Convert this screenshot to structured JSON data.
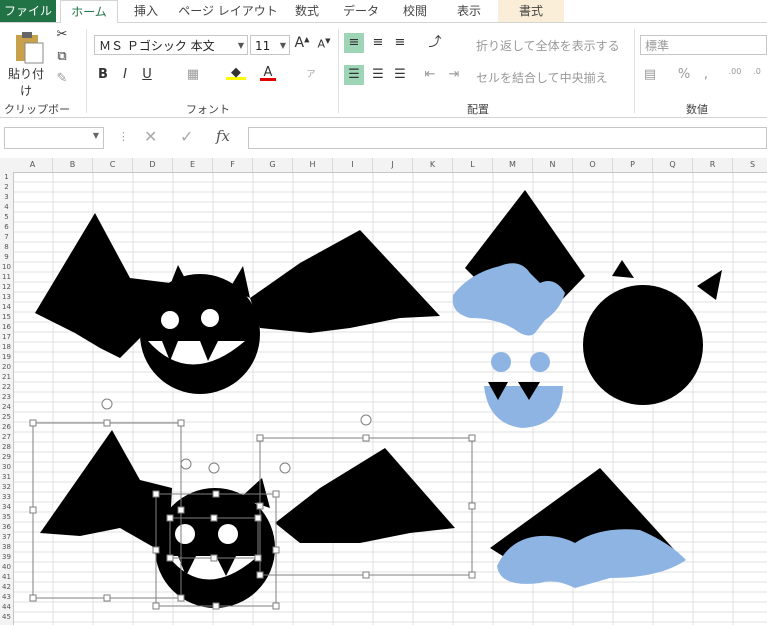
{
  "tabs": [
    "ファイル",
    "ホーム",
    "挿入",
    "ページ レイアウト",
    "数式",
    "データ",
    "校閲",
    "表示",
    "書式"
  ],
  "ribbon": {
    "clipboard": {
      "paste": "貼り付け",
      "label": "クリップボード"
    },
    "font": {
      "name": "ＭＳ Ｐゴシック 本文",
      "size": "11",
      "label": "フォント",
      "bold": "B",
      "italic": "I",
      "underline": "U"
    },
    "alignment": {
      "wrap": "折り返して全体を表示する",
      "merge": "セルを結合して中央揃え",
      "label": "配置"
    },
    "number": {
      "format": "標準",
      "label": "数値"
    }
  },
  "formula_bar": {
    "fx": "fx",
    "name_box": "",
    "content": ""
  },
  "columns": [
    "A",
    "B",
    "C",
    "D",
    "E",
    "F",
    "G",
    "H",
    "I",
    "J",
    "K",
    "L",
    "M",
    "N",
    "O",
    "P",
    "Q",
    "R",
    "S"
  ],
  "rows": [
    "1",
    "2",
    "3",
    "4",
    "5",
    "6",
    "7",
    "8",
    "9",
    "10",
    "11",
    "12",
    "13",
    "14",
    "15",
    "16",
    "17",
    "18",
    "19",
    "20",
    "21",
    "22",
    "23",
    "24",
    "25",
    "26",
    "27",
    "28",
    "29",
    "30",
    "31",
    "32",
    "33",
    "34",
    "35",
    "36",
    "37",
    "38",
    "39",
    "40",
    "41",
    "42",
    "43",
    "44",
    "45"
  ],
  "colors": {
    "accent": "#217346",
    "shape_blue": "#8eb4e3",
    "shape_black": "#000000",
    "grid": "#e1e1e1"
  }
}
